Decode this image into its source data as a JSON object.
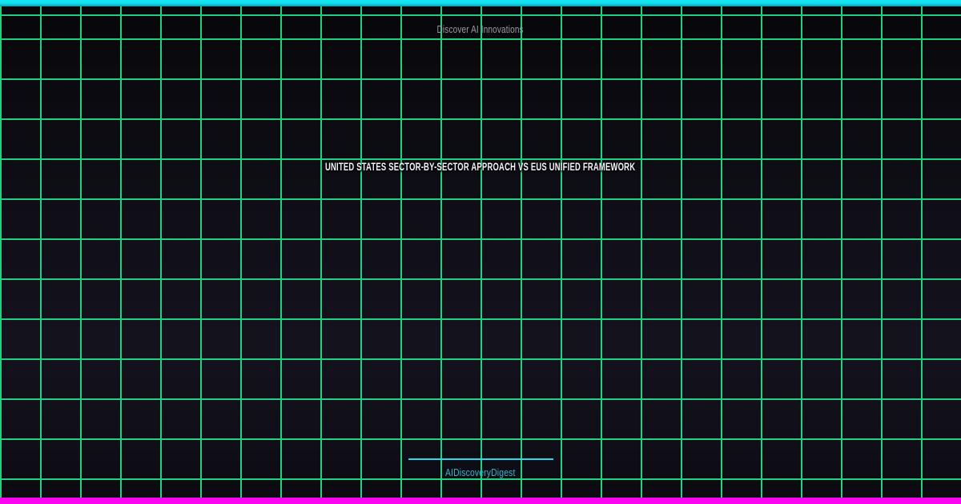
{
  "card": {
    "tagline": "Discover AI Innovations",
    "title": "UNITED STATES SECTOR-BY-SECTOR APPROACH VS EUS UNIFIED FRAMEWORK",
    "brand": "AIDiscoveryDigest"
  },
  "colors": {
    "top_bar_start": "#14e7f4",
    "top_bar_end": "#0a9cab",
    "bottom_bar": "#fb04ef",
    "grid_line": "#22e28b",
    "bg_top": "#07070b",
    "bg_mid": "#14121d",
    "bg_bottom": "#0b0a10",
    "tagline_text": "#9a9aa4",
    "title_text": "#f2f3f5",
    "divider": "#2bd9ec",
    "brand_text": "#36b6cb"
  }
}
